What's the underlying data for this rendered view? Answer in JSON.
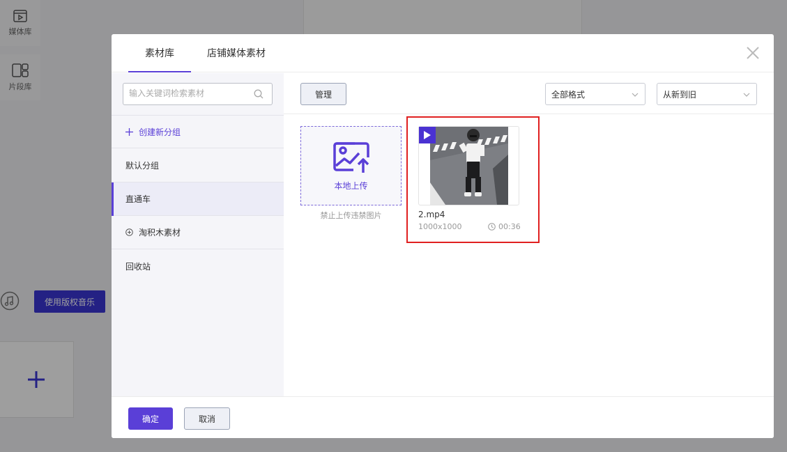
{
  "background": {
    "nav": [
      {
        "label": "媒体库",
        "icon": "media-library-icon"
      },
      {
        "label": "片段库",
        "icon": "clip-library-icon"
      }
    ],
    "music_button": "使用版权音乐"
  },
  "modal": {
    "tabs": [
      {
        "label": "素材库",
        "active": true
      },
      {
        "label": "店铺媒体素材",
        "active": false
      }
    ],
    "sidebar": {
      "search_placeholder": "输入关键词检索素材",
      "create_group": "创建新分组",
      "items": [
        {
          "label": "默认分组",
          "active": false
        },
        {
          "label": "直通车",
          "active": true
        },
        {
          "label": "淘积木素材",
          "active": false,
          "icon": "plus-circle-icon"
        },
        {
          "label": "回收站",
          "active": false
        }
      ]
    },
    "toolbar": {
      "manage": "管理",
      "format_select": "全部格式",
      "sort_select": "从新到旧"
    },
    "upload": {
      "label": "本地上传",
      "note": "禁止上传违禁图片"
    },
    "media": [
      {
        "name": "2.mp4",
        "resolution": "1000x1000",
        "duration": "00:36",
        "type": "video"
      }
    ],
    "footer": {
      "ok": "确定",
      "cancel": "取消"
    }
  },
  "colors": {
    "accent": "#5a3fd7",
    "highlight": "#e02020",
    "overlay": "rgba(0,0,0,0.38)"
  }
}
